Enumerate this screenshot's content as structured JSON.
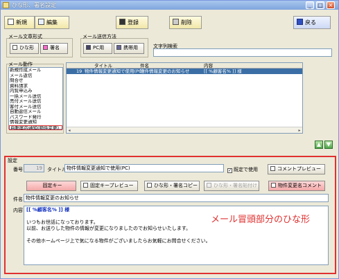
{
  "window": {
    "title": "ひな形、署名設定"
  },
  "toolbar": {
    "new": "新規",
    "edit": "編集",
    "register": "登録",
    "delete": "削除",
    "back": "戻る"
  },
  "template_format": {
    "label": "メール文章形式",
    "template": "ひな形",
    "signature": "署名"
  },
  "send_method": {
    "label": "メール送信方法",
    "pc": "PC用",
    "mobile": "携帯用"
  },
  "search": {
    "label": "文字列検索",
    "value": ""
  },
  "mail_actions": {
    "label": "メール動作",
    "items": [
      "新規作成メール",
      "メール返信",
      "問合せ",
      "資料請求",
      "内覧申込み",
      "一括メール送信",
      "売付メール送信",
      "客付メール送信",
      "自動返信メール",
      "パスワード発行",
      "情報変更通知",
      "自動案内通知(物件変更)"
    ],
    "selected_index": 11
  },
  "grid": {
    "headers": [
      "タイトル",
      "件名",
      "内容"
    ],
    "rows": [
      {
        "no": "19",
        "title": "物件情報変更通知で使用(PC)",
        "subject": "物件情報変更のお知らせ",
        "content": "[[ %顧客名% ]] 様"
      }
    ]
  },
  "settings": {
    "label": "設定",
    "number_label": "番号",
    "number_value": "19",
    "title_label": "タイトル",
    "title_value": "物件情報変更通知で使用(PC)",
    "default_use_label": "既定で使用",
    "comment_preview": "コメントプレビュー",
    "fixed_key": "固定キー",
    "fixed_key_preview": "固定キープレビュー",
    "copy_template": "ひな形・署名コピー",
    "paste_template": "ひな形・署名貼付け",
    "property_comment": "物件変更名コメント",
    "subject_label": "件名",
    "subject_value": "物件情報変更のお知らせ",
    "content_label": "内容",
    "content_lines": [
      "[[ %顧客名% ]] 様",
      "",
      "いつもお世話になっております。",
      "以前、お送りした物件の情報が変更になりましたのでお知らせいたします。",
      "",
      "その他ホームページ上で気になる物件がございましたらお気軽にお問合せください。"
    ],
    "annotation": "メール冒頭部分のひな形"
  }
}
